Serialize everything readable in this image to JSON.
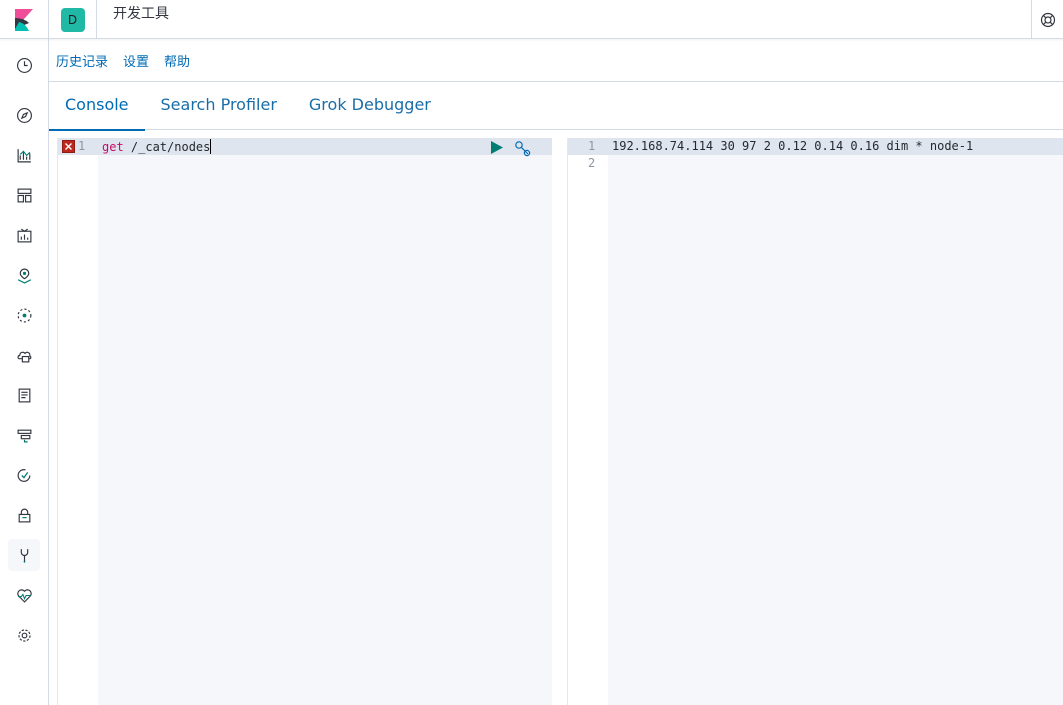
{
  "header": {
    "space_initial": "D",
    "breadcrumb": "开发工具"
  },
  "topmenu": {
    "items": [
      "历史记录",
      "设置",
      "帮助"
    ]
  },
  "tabs": [
    {
      "label": "Console",
      "active": true
    },
    {
      "label": "Search Profiler",
      "active": false
    },
    {
      "label": "Grok Debugger",
      "active": false
    }
  ],
  "sidenav": {
    "items": [
      {
        "name": "recently-viewed-icon"
      },
      {
        "name": "discover-icon"
      },
      {
        "name": "visualize-icon"
      },
      {
        "name": "dashboard-icon"
      },
      {
        "name": "canvas-icon"
      },
      {
        "name": "maps-icon"
      },
      {
        "name": "machine-learning-icon"
      },
      {
        "name": "infrastructure-icon"
      },
      {
        "name": "logs-icon"
      },
      {
        "name": "apm-icon"
      },
      {
        "name": "uptime-icon"
      },
      {
        "name": "siem-icon"
      },
      {
        "name": "dev-tools-icon",
        "active": true
      },
      {
        "name": "monitoring-icon"
      },
      {
        "name": "management-icon"
      }
    ]
  },
  "request_editor": {
    "line_numbers": [
      "1"
    ],
    "method": "get",
    "path": " /_cat/nodes"
  },
  "response_editor": {
    "line_numbers": [
      "1",
      "2"
    ],
    "lines": [
      "192.168.74.114 30 97 2 0.12 0.14 0.16 dim * node-1",
      ""
    ]
  },
  "colors": {
    "accent": "#006bb4",
    "method": "#c80a68",
    "path": "#25282f",
    "run": "#017d73",
    "error": "#bd271e"
  }
}
